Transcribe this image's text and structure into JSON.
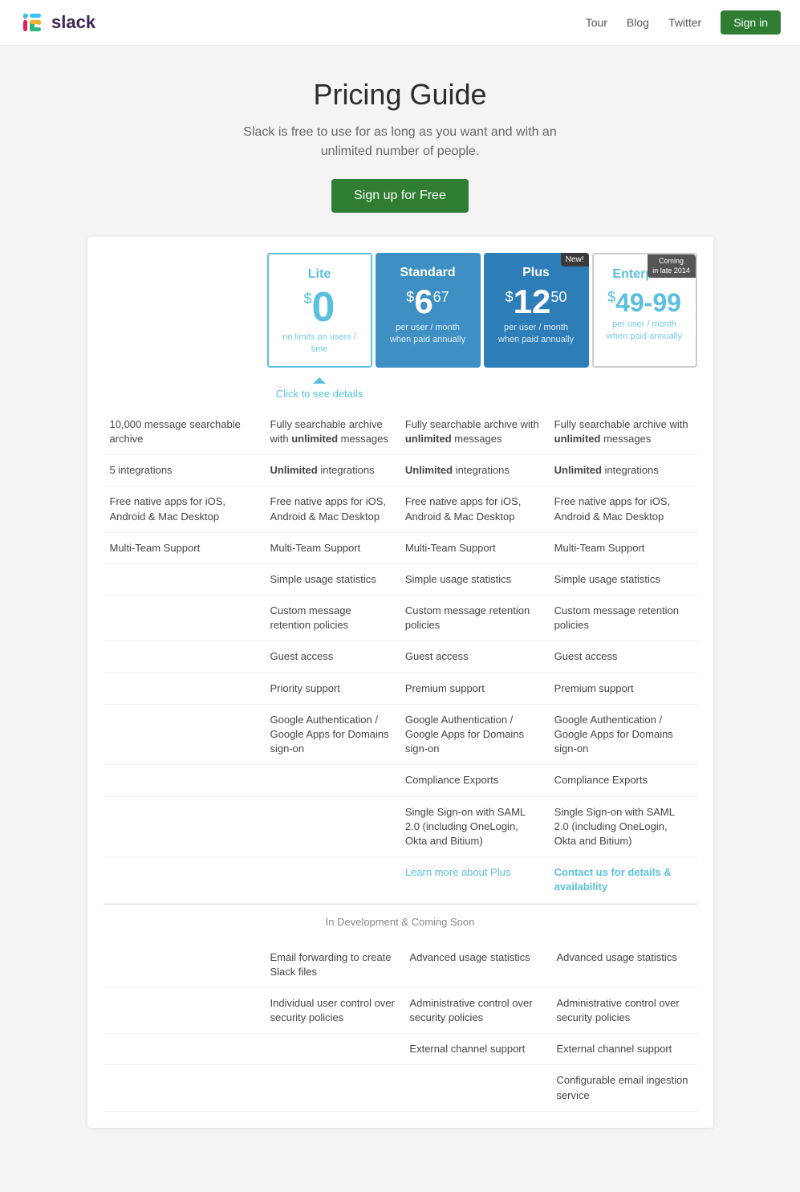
{
  "nav": {
    "logo_text": "slack",
    "links": [
      "Tour",
      "Blog",
      "Twitter"
    ],
    "signin_label": "Sign in"
  },
  "hero": {
    "title": "Pricing Guide",
    "subtitle": "Slack is free to use for as long as you want and with an\nunlimited number of people.",
    "cta_label": "Sign up for Free"
  },
  "plans": [
    {
      "id": "lite",
      "name": "Lite",
      "dollar_sign": "$",
      "amount": "0",
      "cents": "",
      "billing": "no limits on users / time",
      "badge": null
    },
    {
      "id": "standard",
      "name": "Standard",
      "dollar_sign": "$",
      "amount": "6",
      "cents": "67",
      "billing": "per user / month\nwhen paid annually",
      "badge": null
    },
    {
      "id": "plus",
      "name": "Plus",
      "dollar_sign": "$",
      "amount": "12",
      "cents": "50",
      "billing": "per user / month\nwhen paid annually",
      "badge": "New!"
    },
    {
      "id": "enterprise",
      "name": "Enterprise",
      "dollar_sign": "$",
      "amount": "49-99",
      "cents": "",
      "billing": "per user / month\nwhen paid annually",
      "badge": "Coming\nin late 2014"
    }
  ],
  "lite_details_link": "Click to see details",
  "features": [
    {
      "lite": "10,000 message searchable archive",
      "standard": "Fully searchable archive with <b>unlimited</b> messages",
      "plus": "Fully searchable archive with <b>unlimited</b> messages",
      "enterprise": "Fully searchable archive with <b>unlimited</b> messages"
    },
    {
      "lite": "5 integrations",
      "standard": "<b>Unlimited</b> integrations",
      "plus": "<b>Unlimited</b> integrations",
      "enterprise": "<b>Unlimited</b> integrations"
    },
    {
      "lite": "Free native apps for iOS, Android & Mac Desktop",
      "standard": "Free native apps for iOS, Android & Mac Desktop",
      "plus": "Free native apps for iOS, Android & Mac Desktop",
      "enterprise": "Free native apps for iOS, Android & Mac Desktop"
    },
    {
      "lite": "Multi-Team Support",
      "standard": "Multi-Team Support",
      "plus": "Multi-Team Support",
      "enterprise": "Multi-Team Support"
    },
    {
      "lite": "",
      "standard": "Simple usage statistics",
      "plus": "Simple usage statistics",
      "enterprise": "Simple usage statistics"
    },
    {
      "lite": "",
      "standard": "Custom message retention policies",
      "plus": "Custom message retention policies",
      "enterprise": "Custom message retention policies"
    },
    {
      "lite": "",
      "standard": "Guest access",
      "plus": "Guest access",
      "enterprise": "Guest access"
    },
    {
      "lite": "",
      "standard": "Priority support",
      "plus": "Premium support",
      "enterprise": "Premium support"
    },
    {
      "lite": "",
      "standard": "Google Authentication / Google Apps for Domains sign-on",
      "plus": "Google Authentication / Google Apps for Domains sign-on",
      "enterprise": "Google Authentication / Google Apps for Domains sign-on"
    },
    {
      "lite": "",
      "standard": "",
      "plus": "Compliance Exports",
      "enterprise": "Compliance Exports"
    },
    {
      "lite": "",
      "standard": "",
      "plus": "Single Sign-on with SAML 2.0 (including OneLogin, Okta and Bitium)",
      "enterprise": "Single Sign-on with SAML 2.0 (including OneLogin, Okta and Bitium)"
    },
    {
      "lite": "",
      "standard": "",
      "plus": "Learn more about Plus",
      "enterprise": "Contact us for details & availability",
      "is_link_row": true
    }
  ],
  "coming_soon": {
    "label": "In Development & Coming Soon",
    "features": [
      {
        "lite": "",
        "standard": "Email forwarding to create Slack files",
        "plus": "Advanced usage statistics",
        "enterprise": "Advanced usage statistics"
      },
      {
        "lite": "",
        "standard": "Individual user control over security policies",
        "plus": "Administrative control over security policies",
        "enterprise": "Administrative control over security policies"
      },
      {
        "lite": "",
        "standard": "",
        "plus": "External channel support",
        "enterprise": "External channel support"
      },
      {
        "lite": "",
        "standard": "",
        "plus": "",
        "enterprise": "Configurable email ingestion service"
      }
    ]
  }
}
